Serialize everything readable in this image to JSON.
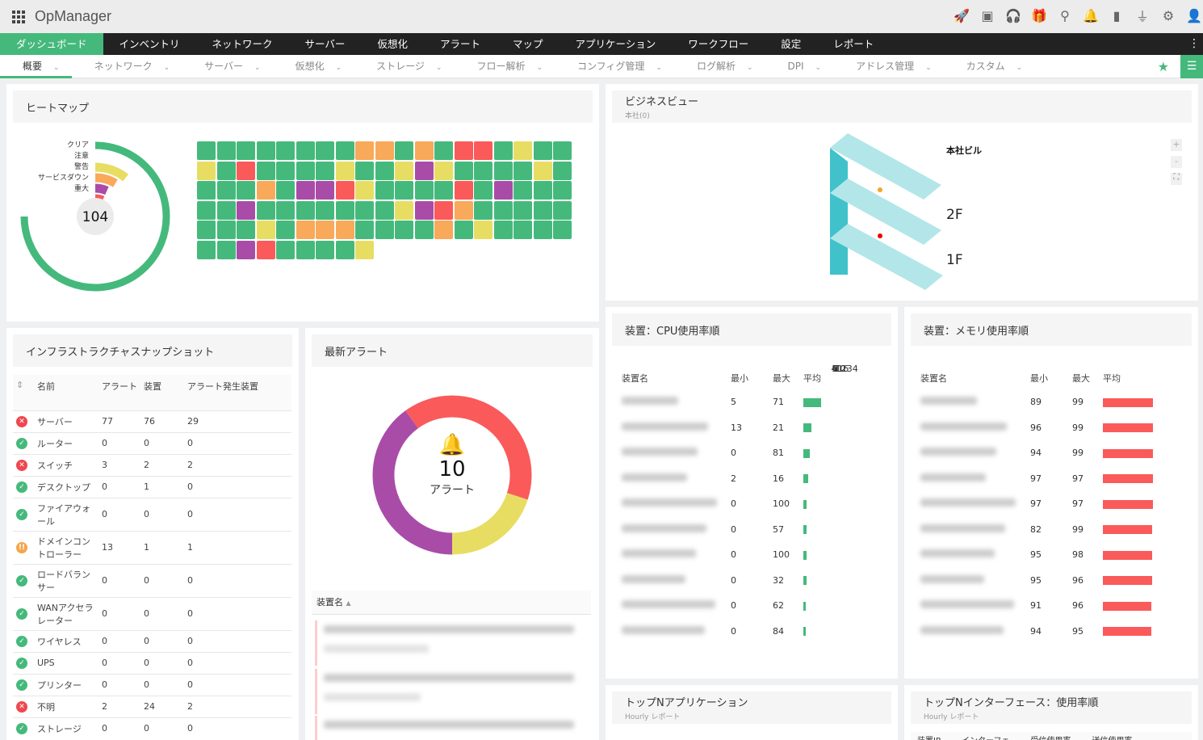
{
  "app": {
    "title": "OpManager"
  },
  "top_icons": [
    "rocket-icon",
    "presentation-icon",
    "headset-icon",
    "gift-icon",
    "search-icon",
    "bell-icon",
    "film-icon",
    "plug-icon",
    "gear-icon",
    "user-avatar-icon"
  ],
  "nav": {
    "items": [
      "ダッシュボード",
      "インベントリ",
      "ネットワーク",
      "サーバー",
      "仮想化",
      "アラート",
      "マップ",
      "アプリケーション",
      "ワークフロー",
      "設定",
      "レポート"
    ],
    "active": 0
  },
  "subnav": {
    "items": [
      "概要",
      "ネットワーク",
      "サーバー",
      "仮想化",
      "ストレージ",
      "フロー解析",
      "コンフィグ管理",
      "ログ解析",
      "DPI",
      "アドレス管理",
      "カスタム"
    ],
    "active": 0
  },
  "colors": {
    "clear": "#45b97c",
    "attention": "#e8dd63",
    "trouble": "#f8a959",
    "service_down": "#a94ca8",
    "critical": "#fa5a5a"
  },
  "heatmap": {
    "title": "ヒートマップ",
    "total": "104",
    "legend": [
      {
        "label": "クリア",
        "key": "clear",
        "count": 70
      },
      {
        "label": "注意",
        "key": "attention",
        "count": 11
      },
      {
        "label": "警告",
        "key": "trouble",
        "count": 9
      },
      {
        "label": "サービスダウン",
        "key": "service_down",
        "count": 7
      },
      {
        "label": "重大",
        "key": "critical",
        "count": 7
      }
    ],
    "rows": [
      "GGGGGGGGOOGOGRRGYGG",
      "YGRGGGGYGGYPYGGGGYG",
      "GGGOGPPRYGGGGRGPGGG",
      "GGPGGGGGGGYPROGGGGG",
      "GGGYGOOOGGGGOGYGGGG",
      "GGPRGGGGY"
    ]
  },
  "business": {
    "title": "ビジネスビュー",
    "subtitle": "本社(0)",
    "building": "本社ビル",
    "floors": [
      "2F",
      "1F"
    ],
    "zoom_in": "+",
    "zoom_out": "-"
  },
  "infra": {
    "title": "インフラストラクチャスナップショット",
    "headers": [
      "名前",
      "アラート",
      "装置",
      "アラート発生装置"
    ],
    "rows": [
      {
        "status": "err",
        "name": "サーバー",
        "alerts": "77",
        "devices": "76",
        "alerted": "29"
      },
      {
        "status": "ok",
        "name": "ルーター",
        "alerts": "0",
        "devices": "0",
        "alerted": "0"
      },
      {
        "status": "err",
        "name": "スイッチ",
        "alerts": "3",
        "devices": "2",
        "alerted": "2"
      },
      {
        "status": "ok",
        "name": "デスクトップ",
        "alerts": "0",
        "devices": "1",
        "alerted": "0"
      },
      {
        "status": "ok",
        "name": "ファイアウォール",
        "alerts": "0",
        "devices": "0",
        "alerted": "0"
      },
      {
        "status": "warn",
        "name": "ドメインコントローラー",
        "alerts": "13",
        "devices": "1",
        "alerted": "1"
      },
      {
        "status": "ok",
        "name": "ロードバランサー",
        "alerts": "0",
        "devices": "0",
        "alerted": "0"
      },
      {
        "status": "ok",
        "name": "WANアクセラレーター",
        "alerts": "0",
        "devices": "0",
        "alerted": "0"
      },
      {
        "status": "ok",
        "name": "ワイヤレス",
        "alerts": "0",
        "devices": "0",
        "alerted": "0"
      },
      {
        "status": "ok",
        "name": "UPS",
        "alerts": "0",
        "devices": "0",
        "alerted": "0"
      },
      {
        "status": "ok",
        "name": "プリンター",
        "alerts": "0",
        "devices": "0",
        "alerted": "0"
      },
      {
        "status": "err",
        "name": "不明",
        "alerts": "2",
        "devices": "24",
        "alerted": "2"
      },
      {
        "status": "ok",
        "name": "ストレージ",
        "alerts": "0",
        "devices": "0",
        "alerted": "0"
      }
    ]
  },
  "alerts": {
    "title": "最新アラート",
    "count": "10",
    "label": "アラート",
    "column": "装置名",
    "segments": [
      {
        "key": "attention",
        "value": 2
      },
      {
        "key": "service_down",
        "value": 4
      },
      {
        "key": "critical",
        "value": 4
      }
    ]
  },
  "cpu": {
    "title": "装置：CPU使用率順",
    "headers": [
      "装置名",
      "最小",
      "最大",
      "平均"
    ],
    "rows": [
      {
        "min": "5",
        "max": "71",
        "avg": 34
      },
      {
        "min": "13",
        "max": "21",
        "avg": 16
      },
      {
        "min": "0",
        "max": "81",
        "avg": 12
      },
      {
        "min": "2",
        "max": "16",
        "avg": 10
      },
      {
        "min": "0",
        "max": "100",
        "avg": 7
      },
      {
        "min": "0",
        "max": "57",
        "avg": 7
      },
      {
        "min": "0",
        "max": "100",
        "avg": 6
      },
      {
        "min": "0",
        "max": "32",
        "avg": 6
      },
      {
        "min": "0",
        "max": "62",
        "avg": 5
      },
      {
        "min": "0",
        "max": "84",
        "avg": 4
      }
    ]
  },
  "memory": {
    "title": "装置：メモリ使用率順",
    "headers": [
      "装置名",
      "最小",
      "最大",
      "平均"
    ],
    "rows": [
      {
        "min": "89",
        "max": "99",
        "avg": 97
      },
      {
        "min": "96",
        "max": "99",
        "avg": 97
      },
      {
        "min": "94",
        "max": "99",
        "avg": 97
      },
      {
        "min": "97",
        "max": "97",
        "avg": 97
      },
      {
        "min": "97",
        "max": "97",
        "avg": 97
      },
      {
        "min": "82",
        "max": "99",
        "avg": 96
      },
      {
        "min": "95",
        "max": "98",
        "avg": 96
      },
      {
        "min": "95",
        "max": "96",
        "avg": 95
      },
      {
        "min": "91",
        "max": "96",
        "avg": 94
      },
      {
        "min": "94",
        "max": "95",
        "avg": 94
      }
    ]
  },
  "topn_apps": {
    "title": "トップNアプリケーション",
    "subtitle": "Hourly レポート"
  },
  "topn_if": {
    "title": "トップNインターフェース：使用率順",
    "subtitle": "Hourly レポート",
    "headers": [
      "装置IP",
      "インターフェ",
      "受信使用率",
      "送信使用率"
    ]
  }
}
